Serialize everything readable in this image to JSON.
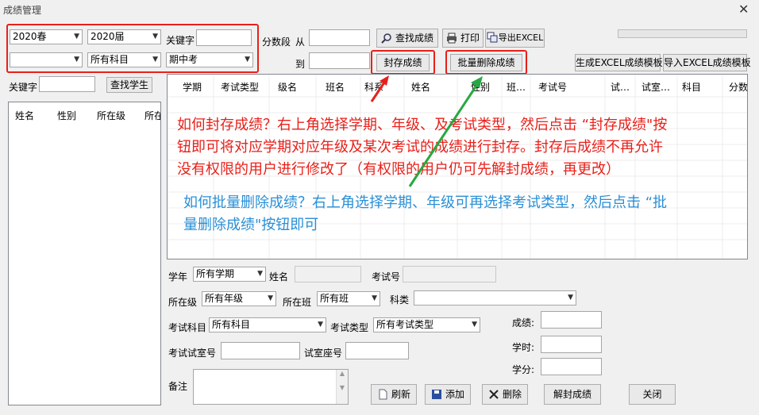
{
  "window": {
    "title": "成绩管理",
    "close_glyph": "✕"
  },
  "filters": {
    "term": "2020春",
    "grade": "2020届",
    "keyword_label": "关键字",
    "keyword_value": "",
    "class": "",
    "subject": "所有科目",
    "exam_type": "期中考",
    "score_range_label": "分数段",
    "from_label": "从",
    "to_label": "到"
  },
  "toolbar": {
    "search_scores": "查找成绩",
    "print": "打印",
    "export_excel": "导出EXCEL",
    "seal_scores": "封存成绩",
    "batch_delete": "批量删除成绩",
    "gen_template": "生成EXCEL成绩模板",
    "import_excel": "导入EXCEL成绩模板"
  },
  "student_search": {
    "keyword_label": "关键字",
    "find_button": "查找学生",
    "columns": [
      "姓名",
      "性别",
      "所在级",
      "所在"
    ]
  },
  "score_grid": {
    "columns": [
      "学期",
      "考试类型",
      "级名",
      "班名",
      "科系",
      "姓名",
      "性别",
      "班…",
      "考试号",
      "试…",
      "试室…",
      "科目",
      "分数"
    ]
  },
  "annotations": {
    "seal_line1": "如何封存成绩？右上角选择学期、年级、及考试类型，然后点击 “封存成绩\"按",
    "seal_line2": "钮即可将对应学期对应年级及某次考试的成绩进行封存。封存后成绩不再允许",
    "seal_line3": "没有权限的用户进行修改了（有权限的用户仍可先解封成绩，再更改）",
    "delete_line1": "如何批量删除成绩？右上角选择学期、年级可再选择考试类型，然后点击 “批",
    "delete_line2": "量删除成绩\"按钮即可"
  },
  "detail_form": {
    "term_label": "学年",
    "term_value": "所有学期",
    "name_label": "姓名",
    "exam_no_label": "考试号",
    "grade_label": "所在级",
    "grade_value": "所有年级",
    "class_label": "所在班",
    "class_value": "所有班",
    "dept_label": "科类",
    "dept_value": "",
    "subject_label": "考试科目",
    "subject_value": "所有科目",
    "exam_type_label": "考试类型",
    "exam_type_value": "所有考试类型",
    "room_label": "考试试室号",
    "seat_label": "试室座号",
    "remark_label": "备注",
    "score_label": "成绩:",
    "hours_label": "学时:",
    "credit_label": "学分:"
  },
  "bottom_buttons": {
    "refresh": "刷新",
    "add": "添加",
    "delete": "删除",
    "unseal": "解封成绩",
    "close": "关闭"
  },
  "colors": {
    "highlight_red": "#e8201a",
    "arrow_green": "#27a842",
    "note_blue": "#2a8fd6"
  }
}
